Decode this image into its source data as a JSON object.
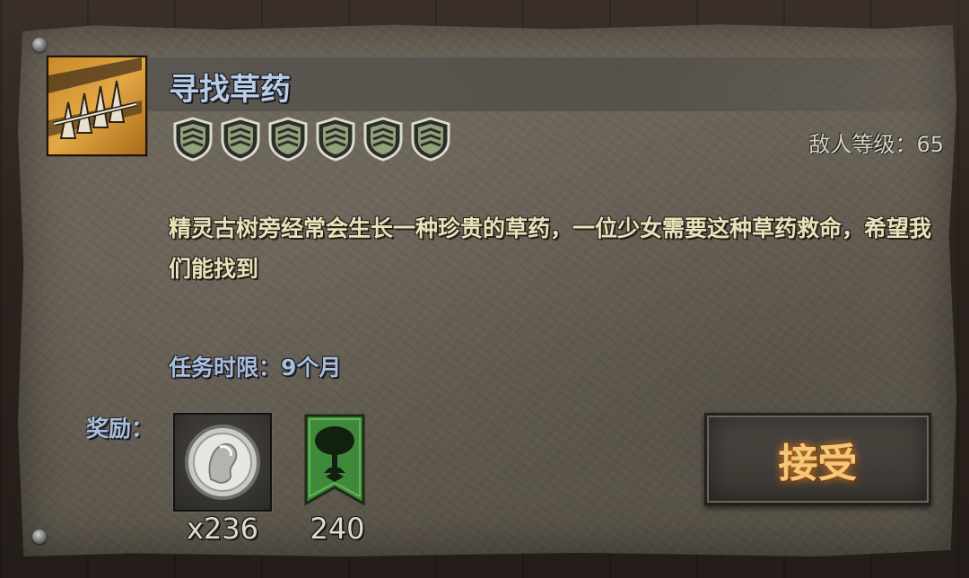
{
  "quest": {
    "title": "寻找草药",
    "difficulty_shields": 6,
    "enemy_level_label": "敌人等级：",
    "enemy_level": "65",
    "description": "精灵古树旁经常会生长一种珍贵的草药，一位少女需要这种草药救命，希望我们能找到",
    "time_limit_label": "任务时限：",
    "time_limit": "9个月"
  },
  "rewards": {
    "label": "奖励：",
    "items": [
      {
        "icon": "silver-coin-icon",
        "count": "x236"
      },
      {
        "icon": "tree-banner-icon",
        "count": "240"
      }
    ]
  },
  "actions": {
    "accept_label": "接受"
  },
  "colors": {
    "title": "#b8cde6",
    "description": "#e9e1b8",
    "accept_text": "#f3c879",
    "banner_green": "#3f8a3a"
  }
}
